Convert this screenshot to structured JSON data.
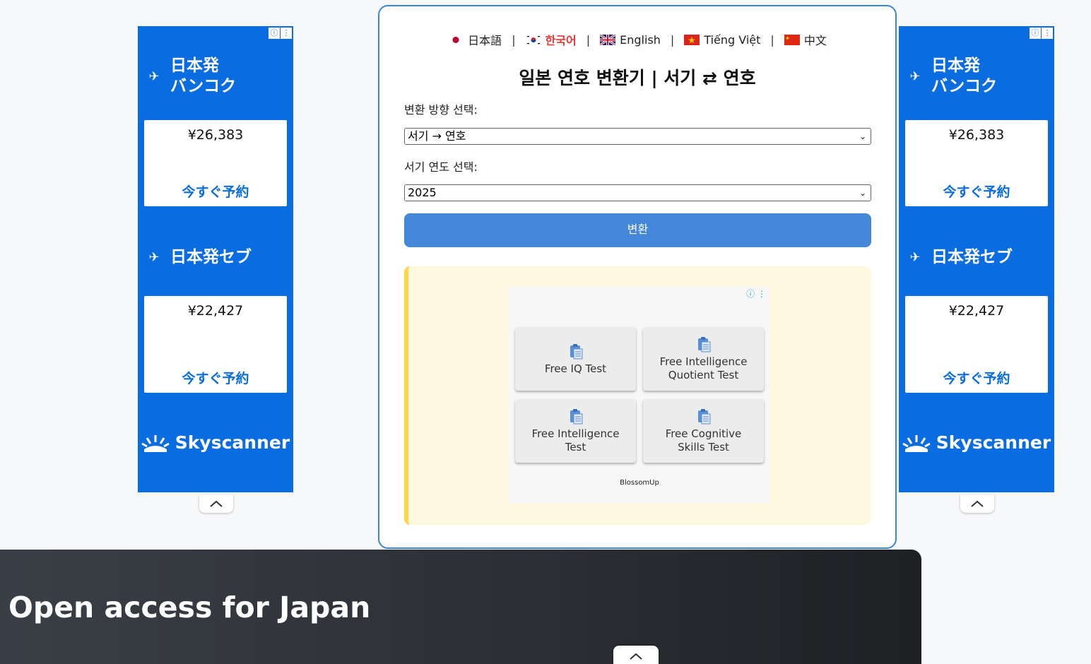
{
  "languages": [
    {
      "label": "日本語",
      "flag": "jp-flag-icon"
    },
    {
      "label": "한국어",
      "flag": "kr-flag-icon",
      "active": true
    },
    {
      "label": "English",
      "flag": "uk-flag-icon"
    },
    {
      "label": "Tiếng Việt",
      "flag": "vn-flag-icon"
    },
    {
      "label": "中文",
      "flag": "cn-flag-icon"
    }
  ],
  "lang_separator": "|",
  "title": "일본 연호 변환기 | 서기 ⇄ 연호",
  "form": {
    "direction_label": "변환 방향 선택:",
    "direction_value": "서기 → 연호",
    "year_label": "서기 연도 선택:",
    "year_value": "2025",
    "convert_label": "변환"
  },
  "side_ads": {
    "deal1": {
      "title": "日本発\nバンコク",
      "price": "¥26,383",
      "cta": "今すぐ予約"
    },
    "deal2": {
      "title": "日本発セブ",
      "price": "¥22,427",
      "cta": "今すぐ予約"
    },
    "brand": "Skyscanner",
    "info_icons": [
      "info-icon",
      "more-vert-icon"
    ]
  },
  "inner_ad": {
    "tiles": [
      {
        "label": "Free IQ Test"
      },
      {
        "label": "Free Intelligence\nQuotient Test"
      },
      {
        "label": "Free Intelligence\nTest"
      },
      {
        "label": "Free Cognitive\nSkills Test"
      }
    ],
    "brand": "BlossomUp"
  },
  "banner": {
    "text": "Open access for Japan"
  },
  "colors": {
    "ad_blue": "#0a6ce1",
    "card_border": "#3c86d6",
    "button_blue": "#4487d8",
    "active_lang": "#e53935",
    "ad_area_bg": "#fff8e0",
    "ad_area_accent": "#ffd54f"
  }
}
